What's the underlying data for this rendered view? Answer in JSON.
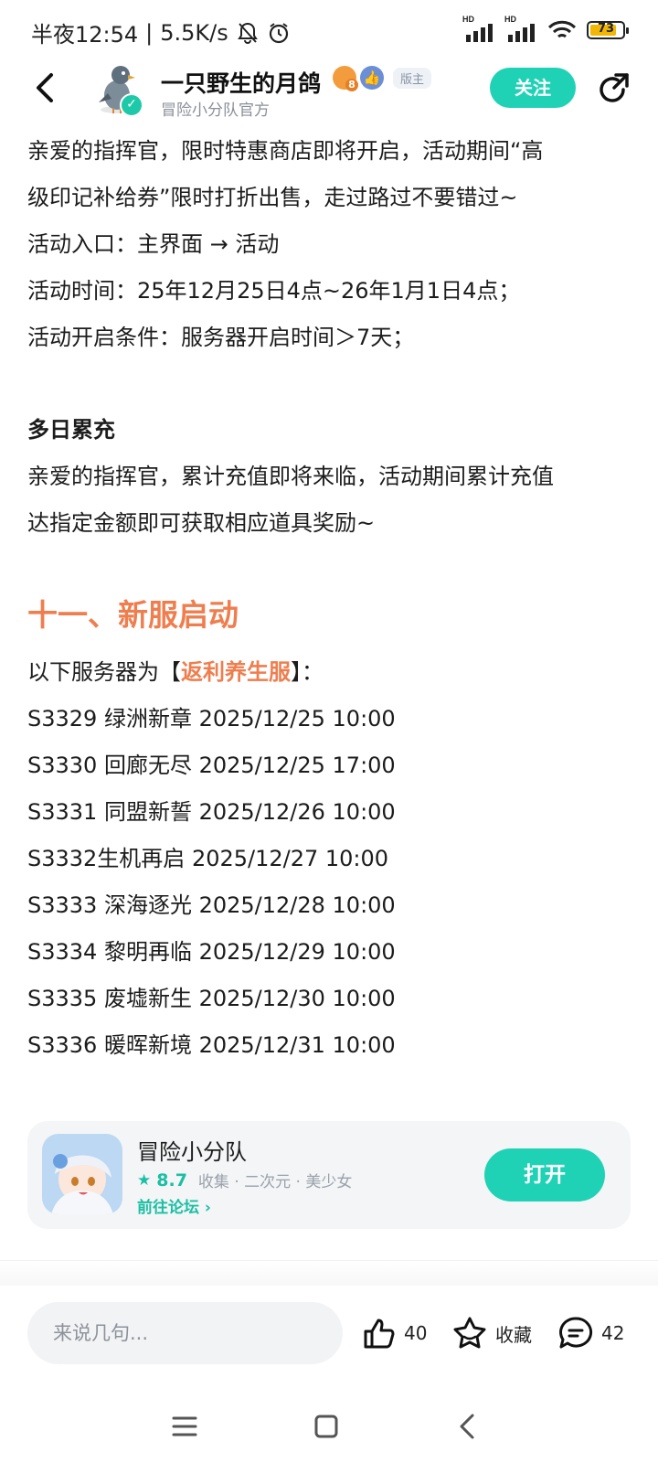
{
  "status": {
    "time": "半夜12:54",
    "speed": "5.5K/s",
    "sig1_label": "HD",
    "sig2_label": "HD",
    "battery": "73",
    "battery_color": "#f2b705"
  },
  "header": {
    "author": "一只野生的月鸽",
    "level": "8",
    "role": "版主",
    "subtitle": "冒险小分队官方",
    "follow_label": "关注",
    "accent": "#20d2b5"
  },
  "article": {
    "p1_line1": "亲爱的指挥官，限时特惠商店即将开启，活动期间“高",
    "p1_line2": "级印记补给券”限时打折出售，走过路过不要错过~",
    "entry": "活动入口：主界面 → 活动",
    "time": "活动时间：25年12月25日4点~26年1月1日4点；",
    "condition": "活动开启条件：服务器开启时间＞7天；",
    "heading2": "多日累充",
    "p2_line1": "亲爱的指挥官，累计充值即将来临，活动期间累计充值",
    "p2_line2": "达指定金额即可获取相应道具奖励~",
    "section_title": "十一、新服启动",
    "servers_intro_prefix": "以下服务器为【",
    "servers_intro_highlight": "返利养生服",
    "servers_intro_suffix": "】：",
    "highlight_color": "#ef7e4f",
    "servers": [
      "S3329  绿洲新章  2025/12/25 10:00",
      "S3330  回廊无尽  2025/12/25 17:00",
      "S3331 同盟新誓  2025/12/26 10:00",
      "S3332生机再启  2025/12/27 10:00",
      "S3333  深海逐光  2025/12/28 10:00",
      "S3334  黎明再临  2025/12/29 10:00",
      "S3335  废墟新生  2025/12/30 10:00",
      "S3336  暖晖新境  2025/12/31 10:00"
    ]
  },
  "app_card": {
    "name": "冒险小分队",
    "rating": "8.7",
    "tags": "收集 · 二次元 · 美少女",
    "forum_link": "前往论坛",
    "open_label": "打开"
  },
  "bottom": {
    "comment_placeholder": "来说几句...",
    "likes": "40",
    "favorite_label": "收藏",
    "comments": "42"
  }
}
